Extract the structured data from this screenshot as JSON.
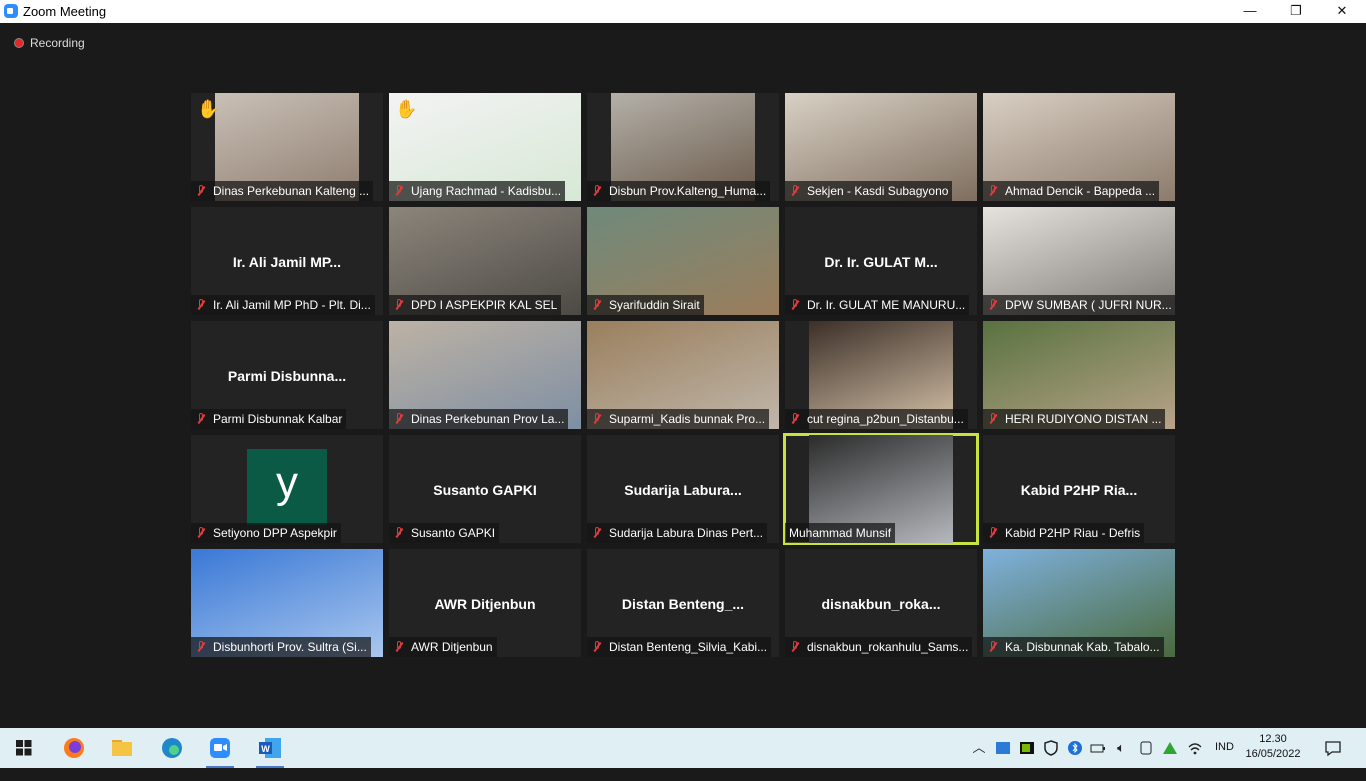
{
  "window": {
    "title": "Zoom Meeting",
    "minimize": "—",
    "maximize": "❐",
    "close": "✕"
  },
  "recording": {
    "label": "Recording"
  },
  "participants": [
    {
      "label": "Dinas Perkebunan Kalteng ...",
      "raised_hand": true
    },
    {
      "label": "Ujang Rachmad - Kadisbu...",
      "raised_hand": true
    },
    {
      "label": "Disbun Prov.Kalteng_Huma..."
    },
    {
      "label": "Sekjen - Kasdi Subagyono"
    },
    {
      "label": "Ahmad Dencik - Bappeda ..."
    },
    {
      "name_display": "Ir. Ali Jamil MP...",
      "label": "Ir. Ali Jamil MP PhD - Plt. Di..."
    },
    {
      "label": "DPD I ASPEKPIR KAL SEL"
    },
    {
      "label": "Syarifuddin Sirait"
    },
    {
      "name_display": "Dr. Ir. GULAT M...",
      "label": "Dr. Ir. GULAT ME MANURU..."
    },
    {
      "label": "DPW SUMBAR ( JUFRI NUR..."
    },
    {
      "name_display": "Parmi  Disbunna...",
      "label": "Parmi Disbunnak Kalbar"
    },
    {
      "label": "Dinas Perkebunan Prov La..."
    },
    {
      "label": "Suparmi_Kadis bunnak Pro..."
    },
    {
      "label": "cut regina_p2bun_Distanbu..."
    },
    {
      "label": "HERI RUDIYONO  DISTAN ..."
    },
    {
      "avatar_letter": "y",
      "label": "Setiyono DPP Aspekpir"
    },
    {
      "name_display": "Susanto GAPKI",
      "label": "Susanto GAPKI"
    },
    {
      "name_display": "Sudarija  Labura...",
      "label": "Sudarija Labura Dinas Pert..."
    },
    {
      "label": "Muhammad Munsif",
      "active_speaker": true,
      "muted": false
    },
    {
      "name_display": "Kabid  P2HP  Ria...",
      "label": "Kabid P2HP Riau - Defris"
    },
    {
      "label": "Disbunhorti Prov. Sultra (Si..."
    },
    {
      "name_display": "AWR Ditjenbun",
      "label": "AWR Ditjenbun"
    },
    {
      "name_display": "Distan  Benteng_...",
      "label": "Distan Benteng_Silvia_Kabi..."
    },
    {
      "name_display": "disnakbun_roka...",
      "label": "disnakbun_rokanhulu_Sams..."
    },
    {
      "label": "Ka. Disbunnak Kab. Tabalo..."
    }
  ],
  "taskbar": {
    "tray_language": "IND",
    "time": "12.30",
    "date": "16/05/2022"
  }
}
